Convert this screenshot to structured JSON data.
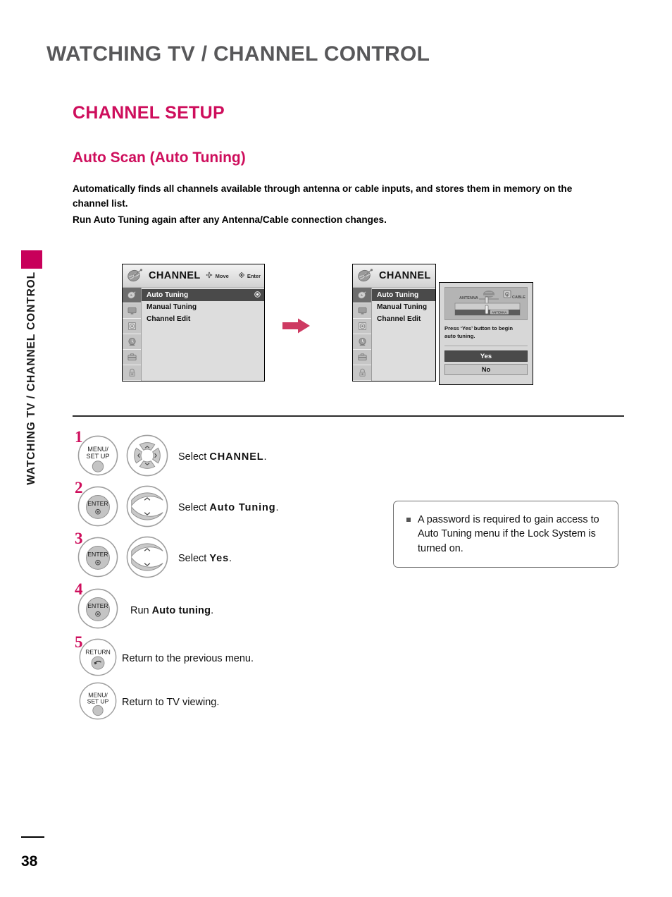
{
  "page": {
    "number": "38",
    "chapter_title": "WATCHING TV / CHANNEL CONTROL",
    "sidebar_vertical_label": "WATCHING TV / CHANNEL CONTROL",
    "accent_color": "#ce0e5c",
    "chapter_color": "#58585a"
  },
  "headings": {
    "section": "CHANNEL SETUP",
    "subsection": "Auto Scan (Auto Tuning)"
  },
  "intro": {
    "line1": "Automatically finds all channels available through antenna or cable inputs, and stores them in memory on the",
    "line2": "channel list.",
    "line3": "Run Auto Tuning again after any Antenna/Cable connection changes."
  },
  "tv_menu": {
    "header_title": "CHANNEL",
    "hint_move": "Move",
    "hint_enter": "Enter",
    "dish_icon": "satellite-dish-icon",
    "move_icon": "dpad-move-icon",
    "enter_icon": "enter-dot-icon",
    "sidebar_icons": [
      "channel-dish-icon",
      "picture-tv-icon",
      "audio-speaker-icon",
      "time-clock-icon",
      "option-toolbox-icon",
      "lock-padlock-icon"
    ],
    "items": [
      {
        "label": "Auto Tuning",
        "selected": true,
        "trailing_icon": "radio-selected-icon"
      },
      {
        "label": "Manual Tuning",
        "selected": false,
        "trailing_icon": ""
      },
      {
        "label": "Channel Edit",
        "selected": false,
        "trailing_icon": ""
      }
    ]
  },
  "dialog": {
    "graphic_labels": {
      "antenna": "ANTENNA",
      "cable": "CABLE",
      "slider": "ANTENNA"
    },
    "graphic_icon": "antenna-cable-selector-icon",
    "message_line1": "Press ‘Yes’ button to begin",
    "message_line2": "auto tuning.",
    "buttons": [
      {
        "label": "Yes",
        "style": "primary"
      },
      {
        "label": "No",
        "style": "secondary"
      }
    ]
  },
  "flow": {
    "arrow_icon": "right-arrow-icon",
    "arrow_color": "#ce3a62"
  },
  "steps": [
    {
      "number": "1",
      "button": {
        "name": "menu-setup-button",
        "line1": "MENU/",
        "line2": "SET UP"
      },
      "pad": {
        "name": "four-way-navigation-pad",
        "type": "dpad4"
      },
      "text_prefix": "Select ",
      "text_bold": "CHANNEL",
      "text_suffix": "."
    },
    {
      "number": "2",
      "button": {
        "name": "enter-button",
        "line1": "ENTER",
        "line2": ""
      },
      "pad": {
        "name": "up-down-navigation-pad",
        "type": "updown"
      },
      "text_prefix": "Select ",
      "text_bold": "Auto Tuning",
      "text_suffix": "."
    },
    {
      "number": "3",
      "button": {
        "name": "enter-button",
        "line1": "ENTER",
        "line2": ""
      },
      "pad": {
        "name": "up-down-navigation-pad",
        "type": "updown"
      },
      "text_prefix": "Select ",
      "text_bold": "Yes",
      "text_suffix": "."
    },
    {
      "number": "4",
      "button": {
        "name": "enter-button",
        "line1": "ENTER",
        "line2": ""
      },
      "pad": {
        "name": "",
        "type": "none"
      },
      "text_prefix": "Run ",
      "text_bold": "Auto tuning",
      "text_suffix": "."
    },
    {
      "number": "5",
      "button": {
        "name": "return-button",
        "line1": "RETURN",
        "line2": ""
      },
      "pad": {
        "name": "",
        "type": "none"
      },
      "text_prefix": "Return to the previous menu.",
      "text_bold": "",
      "text_suffix": ""
    },
    {
      "number": "",
      "button": {
        "name": "menu-setup-button",
        "line1": "MENU/",
        "line2": "SET UP"
      },
      "pad": {
        "name": "",
        "type": "none"
      },
      "text_prefix": "Return to TV viewing.",
      "text_bold": "",
      "text_suffix": ""
    }
  ],
  "note": {
    "bullet_icon": "square-bullet-icon",
    "text": "A password is required to gain access to Auto Tuning menu if the Lock System is turned on."
  }
}
